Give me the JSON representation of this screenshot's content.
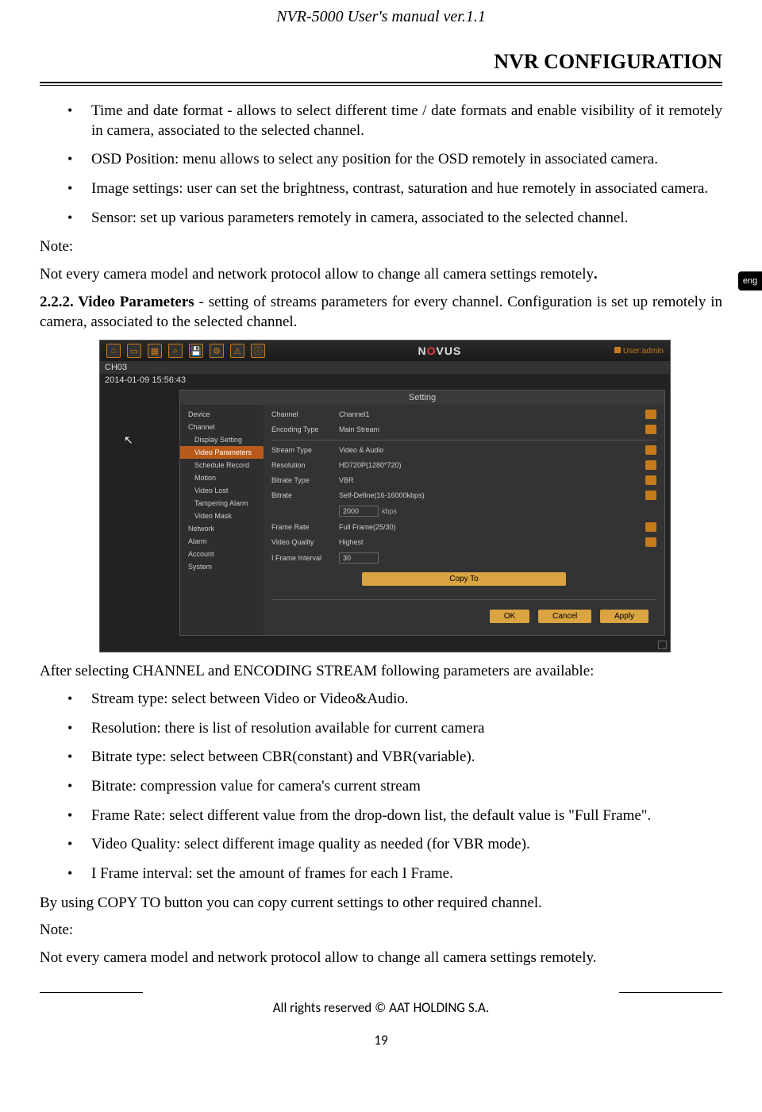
{
  "header": {
    "title": "NVR-5000 User's manual ver.1.1"
  },
  "section": {
    "title": "NVR CONFIGURATION"
  },
  "lang_tab": "eng",
  "bullets1": [
    "Time and date format - allows to select different time / date formats and enable visibility of it remotely in camera, associated to the selected channel.",
    "OSD Position: menu allows to select any position for the OSD remotely in associated camera.",
    "Image settings: user can set the brightness, contrast, saturation and hue remotely in associated camera.",
    "Sensor: set up various parameters remotely in camera, associated to the selected channel."
  ],
  "note1_label": "Note:",
  "note1_text": "Not every camera model and network protocol allow to change all camera settings remotely",
  "note1_dot": ".",
  "sec222_num": "2.2.2. Video Parameters",
  "sec222_text": " - setting of streams parameters for every channel. Configuration is set up remotely in camera, associated to the selected channel.",
  "screenshot": {
    "logo_pre": "N",
    "logo_o": "O",
    "logo_post": "VUS",
    "user": "User:admin",
    "ch": "CH03",
    "time": "2014-01-09   15:56:43",
    "panel_title": "Setting",
    "menu": [
      {
        "label": "Device",
        "sub": false
      },
      {
        "label": "Channel",
        "sub": false
      },
      {
        "label": "Display Setting",
        "sub": true
      },
      {
        "label": "Video Parameters",
        "sub": true,
        "active": true
      },
      {
        "label": "Schedule Record",
        "sub": true
      },
      {
        "label": "Motion",
        "sub": true
      },
      {
        "label": "Video Lost",
        "sub": true
      },
      {
        "label": "Tampering Alarm",
        "sub": true
      },
      {
        "label": "Video Mask",
        "sub": true
      },
      {
        "label": "Network",
        "sub": false
      },
      {
        "label": "Alarm",
        "sub": false
      },
      {
        "label": "Account",
        "sub": false
      },
      {
        "label": "System",
        "sub": false
      }
    ],
    "rows": [
      {
        "label": "Channel",
        "value": "Channel1",
        "dd": true
      },
      {
        "label": "Encoding Type",
        "value": "Main Stream",
        "dd": true,
        "hr": true
      },
      {
        "label": "Stream Type",
        "value": "Video & Audio",
        "dd": true
      },
      {
        "label": "Resolution",
        "value": "HD720P(1280*720)",
        "dd": true
      },
      {
        "label": "Bitrate Type",
        "value": "VBR",
        "dd": true
      },
      {
        "label": "Bitrate",
        "value": "Self-Define(16-16000kbps)",
        "dd": true
      },
      {
        "label": "",
        "value": "",
        "input": "2000",
        "unit": "kbps"
      },
      {
        "label": "Frame Rate",
        "value": "Full Frame(25/30)",
        "dd": true
      },
      {
        "label": "Video Quality",
        "value": "Highest",
        "dd": true
      },
      {
        "label": "I Frame Interval",
        "value": "",
        "input": "30"
      }
    ],
    "copy_btn": "Copy To",
    "ok_btn": "OK",
    "cancel_btn": "Cancel",
    "apply_btn": "Apply"
  },
  "after_ss": "After selecting CHANNEL and ENCODING STREAM following parameters are available:",
  "bullets2": [
    "Stream type: select between Video or Video&Audio.",
    "Resolution: there is list of resolution available for current camera",
    "Bitrate type: select between CBR(constant) and VBR(variable).",
    "Bitrate: compression value for camera's current stream",
    "Frame Rate: select different value from the drop-down list, the default value is \"Full Frame\".",
    "Video Quality: select different image quality as needed (for VBR mode).",
    "I Frame interval: set the amount of frames for each I Frame."
  ],
  "copy_para": "By using COPY TO button you can copy current settings to other required channel.",
  "note2_label": "Note:",
  "note2_text": "Not every camera model and network protocol allow to change all camera settings remotely.",
  "footer": "All rights reserved © AAT HOLDING S.A.",
  "page": "19"
}
